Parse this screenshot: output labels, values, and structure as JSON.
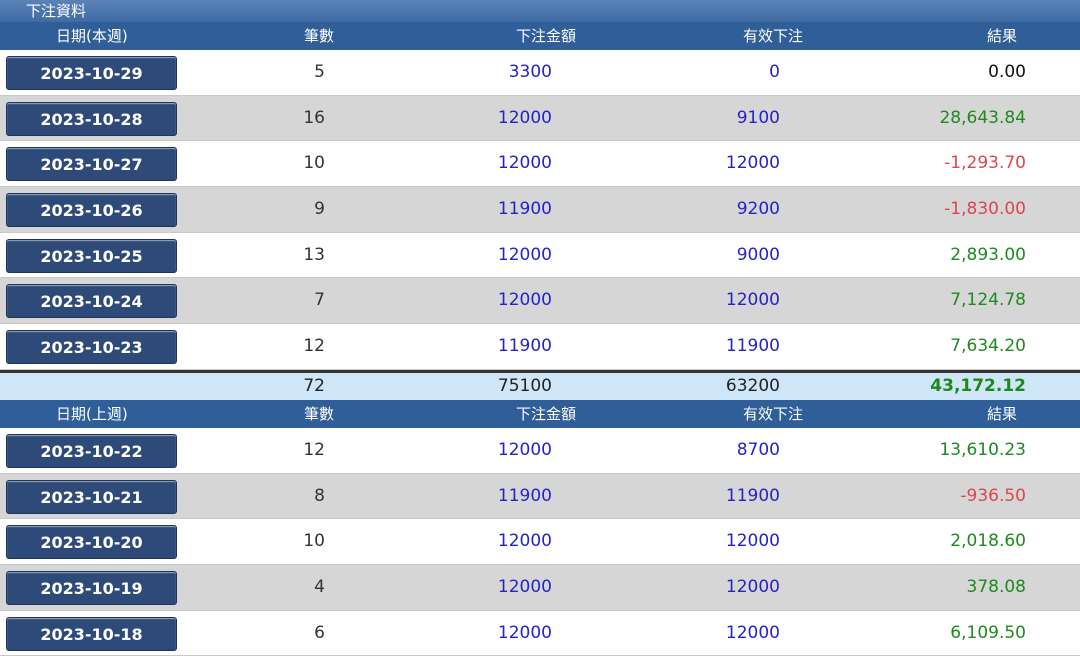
{
  "title": "下注資料",
  "headers_this_week": {
    "date": "日期(本週)",
    "count": "筆數",
    "bet": "下注金額",
    "valid": "有效下注",
    "result": "結果"
  },
  "this_week_rows": [
    {
      "date": "2023-10-29",
      "count": "5",
      "bet": "3300",
      "valid": "0",
      "result": "0.00",
      "sign": "zero"
    },
    {
      "date": "2023-10-28",
      "count": "16",
      "bet": "12000",
      "valid": "9100",
      "result": "28,643.84",
      "sign": "pos"
    },
    {
      "date": "2023-10-27",
      "count": "10",
      "bet": "12000",
      "valid": "12000",
      "result": "-1,293.70",
      "sign": "neg"
    },
    {
      "date": "2023-10-26",
      "count": "9",
      "bet": "11900",
      "valid": "9200",
      "result": "-1,830.00",
      "sign": "neg"
    },
    {
      "date": "2023-10-25",
      "count": "13",
      "bet": "12000",
      "valid": "9000",
      "result": "2,893.00",
      "sign": "pos"
    },
    {
      "date": "2023-10-24",
      "count": "7",
      "bet": "12000",
      "valid": "12000",
      "result": "7,124.78",
      "sign": "pos"
    },
    {
      "date": "2023-10-23",
      "count": "12",
      "bet": "11900",
      "valid": "11900",
      "result": "7,634.20",
      "sign": "pos"
    }
  ],
  "totals": {
    "count": "72",
    "bet": "75100",
    "valid": "63200",
    "result": "43,172.12"
  },
  "headers_last_week": {
    "date": "日期(上週)",
    "count": "筆數",
    "bet": "下注金額",
    "valid": "有效下注",
    "result": "結果"
  },
  "last_week_rows": [
    {
      "date": "2023-10-22",
      "count": "12",
      "bet": "12000",
      "valid": "8700",
      "result": "13,610.23",
      "sign": "pos"
    },
    {
      "date": "2023-10-21",
      "count": "8",
      "bet": "11900",
      "valid": "11900",
      "result": "-936.50",
      "sign": "neg"
    },
    {
      "date": "2023-10-20",
      "count": "10",
      "bet": "12000",
      "valid": "12000",
      "result": "2,018.60",
      "sign": "pos"
    },
    {
      "date": "2023-10-19",
      "count": "4",
      "bet": "12000",
      "valid": "12000",
      "result": "378.08",
      "sign": "pos"
    },
    {
      "date": "2023-10-18",
      "count": "6",
      "bet": "12000",
      "valid": "12000",
      "result": "6,109.50",
      "sign": "pos"
    }
  ],
  "colors": {
    "header_bg": "#2f5e98",
    "date_button": "#2e4a78",
    "positive": "#1e8a1e",
    "negative": "#e0454f",
    "amount": "#2323c8",
    "total_bg": "#cfe6f8"
  }
}
